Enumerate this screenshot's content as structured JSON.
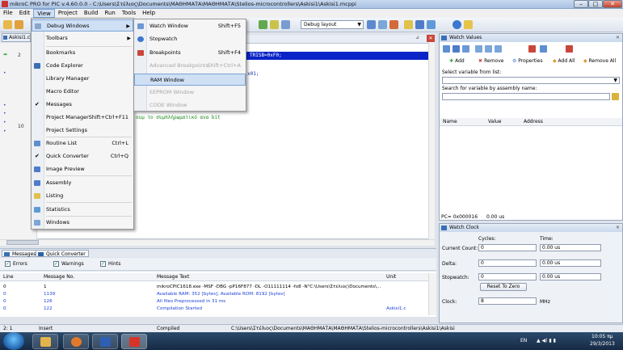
{
  "window": {
    "title": "mikroC PRO for PIC v.4.60.0.0 - C:\\Users\\Στέλιος\\Documents\\ΜΑΘΗΜΑΤΑ\\ΜΑΘΗΜΑΤΑ\\Stelios-microcontrollers\\Askisi1\\Askisi1.mcppi",
    "min": "–",
    "max": "□",
    "close": "✕"
  },
  "menubar": [
    "File",
    "Edit",
    "View",
    "Project",
    "Build",
    "Run",
    "Tools",
    "Help"
  ],
  "toolbar": {
    "layout": "Debug layout"
  },
  "editor": {
    "tab": "Askisi1.c",
    "line_numbers": [
      "2",
      "10"
    ],
    "highlight_code": "TRISB=0xF0;",
    "code_fragment": "x01;",
    "comment": "ουμ το συμπλήρωματικό ανα bit"
  },
  "view_menu": {
    "items": [
      {
        "label": "Debug Windows",
        "shortcut": "",
        "submenu": true,
        "active": true
      },
      {
        "label": "Toolbars",
        "shortcut": "",
        "submenu": true
      },
      {
        "label": "Bookmarks",
        "shortcut": ""
      },
      {
        "label": "Code Explorer",
        "shortcut": ""
      },
      {
        "label": "Library Manager",
        "shortcut": ""
      },
      {
        "label": "Macro Editor",
        "shortcut": ""
      },
      {
        "label": "Messages",
        "shortcut": "",
        "checked": true
      },
      {
        "label": "Project Manager",
        "shortcut": "Shift+Ctrl+F11"
      },
      {
        "label": "Project Settings",
        "shortcut": ""
      },
      {
        "label": "Routine List",
        "shortcut": "Ctrl+L"
      },
      {
        "label": "Quick Converter",
        "shortcut": "Ctrl+Q",
        "checked": true
      },
      {
        "label": "Image Preview",
        "shortcut": ""
      },
      {
        "label": "Assembly",
        "shortcut": ""
      },
      {
        "label": "Listing",
        "shortcut": ""
      },
      {
        "label": "Statistics",
        "shortcut": ""
      },
      {
        "label": "Windows",
        "shortcut": ""
      }
    ]
  },
  "debug_menu": {
    "items": [
      {
        "label": "Watch Window",
        "shortcut": "Shift+F5"
      },
      {
        "label": "Stopwatch",
        "shortcut": ""
      },
      {
        "label": "Breakpoints",
        "shortcut": "Shift+F4"
      },
      {
        "label": "Advanced Breakpoints",
        "shortcut": "Shift+Ctrl+A",
        "disabled": true
      },
      {
        "label": "RAM Window",
        "shortcut": "",
        "active": true
      },
      {
        "label": "EEPROM Window",
        "shortcut": "",
        "disabled": true
      },
      {
        "label": "CODE Window",
        "shortcut": "",
        "disabled": true
      }
    ]
  },
  "messages": {
    "tabs": [
      "Messages",
      "Quick Converter"
    ],
    "filters": [
      "Errors",
      "Warnings",
      "Hints"
    ],
    "columns": [
      "Line",
      "Message No.",
      "Message Text",
      "Unit"
    ],
    "rows": [
      {
        "line": "0",
        "no": "1",
        "text": "mikroCPIC1618.exe -MSF -DBG -pP16F877 -DL -O11111114 -fo8 -N\"C:\\Users\\Στέλιος\\Documents\\...",
        "unit": "",
        "blue": false
      },
      {
        "line": "0",
        "no": "1139",
        "text": "Available RAM: 352 [bytes], Available ROM: 8192 [bytes]",
        "unit": "",
        "blue": true
      },
      {
        "line": "0",
        "no": "126",
        "text": "All files Preprocessed in 31 ms",
        "unit": "",
        "blue": true
      },
      {
        "line": "0",
        "no": "122",
        "text": "Compilation Started",
        "unit": "Askisi1.c",
        "blue": true
      }
    ]
  },
  "statusbar": {
    "pos": "2: 1",
    "mode": "Insert",
    "state": "Compiled",
    "path": "C:\\Users\\Στέλιος\\Documents\\ΜΑΘΗΜΑΤΑ\\ΜΑΘΗΜΑΤΑ\\Stelios-microcontrollers\\Askisi1\\Askisi"
  },
  "watch": {
    "title": "Watch Values",
    "add": "Add",
    "remove": "Remove",
    "properties": "Properties",
    "add_all": "Add All",
    "remove_all": "Remove All",
    "select_label": "Select variable from list:",
    "search_label": "Search for variable by assembly name:",
    "columns": [
      "Name",
      "Value",
      "Address"
    ],
    "pc": "PC= 0x000016",
    "time": "0.00 us"
  },
  "clock": {
    "title": "Watch Clock",
    "cycles_label": "Cycles:",
    "time_label": "Time:",
    "current_count_label": "Current Count:",
    "current_count": "0",
    "current_time": "0.00 us",
    "delta_label": "Delta:",
    "delta": "0",
    "delta_time": "0.00 us",
    "stopwatch_label": "Stopwatch:",
    "stopwatch": "0",
    "stopwatch_time": "0.00 us",
    "reset_label": "Reset To Zero",
    "clock_label": "Clock:",
    "clock_value": "8",
    "unit": "MHz"
  },
  "taskbar": {
    "lang": "EN",
    "time": "10:05 πμ",
    "date": "29/3/2013"
  }
}
